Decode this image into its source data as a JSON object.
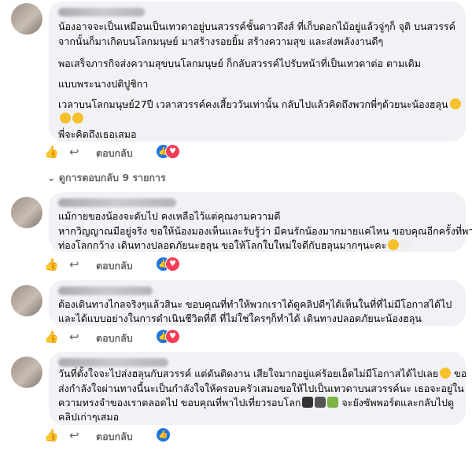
{
  "comments": [
    {
      "lines": [
        "น้องอาจจะเป็นเหมือนเป็นเทวดาอยู่บนสวรรค์ชั้นดาวดึงส์ ที่เก็บดอกไม้อยู่แล้วจู่ๆก็ จุติ บนสวรรค์",
        "จากนั้นก็มาเกิดบนโลกมนุษย์ มาสร้างรอยยิ้ม สร้างความสุข และส่งพลังงานดีๆ",
        "",
        "พอเสร็จภารกิจส่งความสุขบนโลกมนุษย์ ก็กลับสวรรค์ไปรับหน้าที่เป็นเทวดาต่อ ตามเดิม",
        "",
        "แบบพระนางปติปูชิกา",
        "",
        "เวลาบนโลกมนุษย์27ปี เวลาสวรรค์คงเสี้ยววันเท่านั้น กลับไปแล้วคิดถึงพวกพี่ๆด้วยนะน้องฮลุน",
        "",
        "",
        "พี่จะคิดถึงเธอเสมอ"
      ],
      "reply_label": "ตอบกลับ"
    },
    {
      "lines": [
        "แม้กายของน้องจะดับไป คงเหลือไว้แต่คุณงามความดี",
        "หากวิญญาณมีอยู่จริง ขอให้น้องมองเห็นและรับรู้ว่า มีคนรักน้องมากมายแค่ไหน ขอบคุณอีกครั้งที่พา",
        "ท่องโลกกว้าง เดินทางปลอดภัยนะฮลุน ขอให้โลกใบใหม่ใจดีกับฮลุนมากๆนะคะ"
      ],
      "reply_label": "ตอบกลับ"
    },
    {
      "lines": [
        "ต้องเดินทางไกลจริงๆแล้วสินะ ขอบคุณที่ทำให้พวกเราได้ดูคลิปดีๆได้เห็นในที่ที่ไม่มีโอกาสได้ไป",
        "และได้แบบอย่างในการดำเนินชีวิตที่ดี ที่ไม่ใช่ใครๆก็ทำได้ เดินทางปลอดภัยนะน้องฮลุน"
      ],
      "reply_label": "ตอบกลับ"
    },
    {
      "lines": [
        "วันที่ตั้งใจจะไปส่งฮลุนกับสวรรค์ แต่ดันติดงาน เสียใจมากอยู่แค่ร้อยเอ็ดไม่มีโอกาสได้ไปเลย",
        "ส่งกำลังใจผ่านทางนี้นะเป็นกำลังใจให้ครอบครัวเสมอขอให้ไปเป็นเทวดาบนสวรรค์นะ เธอจะอยู่ใน",
        "ความทรงจำของเราตลอดไป ขอบคุณที่พาไปเที่ยวรอบโลก",
        "คลิปเก่าๆเสมอ"
      ],
      "line3_tail": "จะยังซัพพอร์ตและกลับไปดู",
      "line1_tail": "ขอ",
      "reply_label": "ตอบกลับ"
    }
  ],
  "view_replies": "ดูการตอบกลับ 9 รายการ",
  "icons": {
    "like": "thumbs-up-icon",
    "reply": "reply-arrow-icon",
    "reaction_like": "like-reaction-icon",
    "reaction_love": "love-reaction-icon"
  },
  "colors": {
    "bubble": "#f0f2f5",
    "meta_text": "#65676b",
    "like_blue": "#1b74e4",
    "love_red": "#f33e58"
  }
}
